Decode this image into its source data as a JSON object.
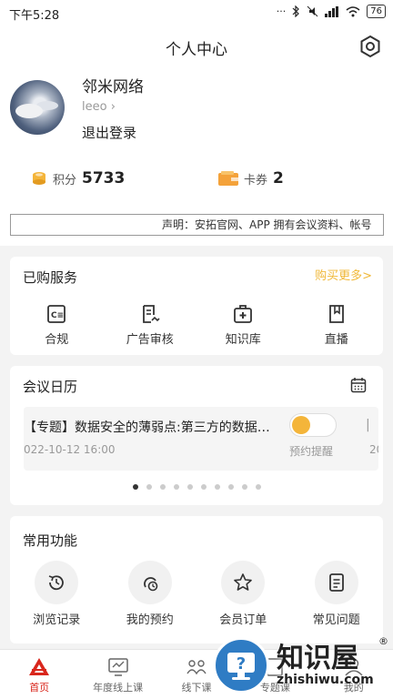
{
  "status_bar": {
    "time": "下午5:28",
    "battery": "76"
  },
  "header": {
    "title": "个人中心"
  },
  "profile": {
    "name": "邻米网络",
    "username": "leeo",
    "username_chevron": "›",
    "logout": "退出登录"
  },
  "stats": {
    "points_label": "积分",
    "points_value": "5733",
    "coupons_label": "卡券",
    "coupons_value": "2"
  },
  "notice": {
    "text": "声明：安拓官网、APP 拥有会议资料、帐号"
  },
  "purchased": {
    "title": "已购服务",
    "more": "购买更多>",
    "items": [
      {
        "label": "合规",
        "icon": "compliance-icon"
      },
      {
        "label": "广告审核",
        "icon": "ad-review-icon"
      },
      {
        "label": "知识库",
        "icon": "knowledge-base-icon"
      },
      {
        "label": "直播",
        "icon": "live-icon"
      }
    ]
  },
  "calendar": {
    "title": "会议日历",
    "item": {
      "title": "【专题】数据安全的薄弱点:第三方的数据…",
      "date": "022-10-12 16:00",
      "remind": "预约提醒"
    },
    "next_peek": {
      "title": "|",
      "date": "20"
    },
    "dots_total": 10,
    "active_dot": 0
  },
  "common": {
    "title": "常用功能",
    "items": [
      {
        "label": "浏览记录",
        "icon": "history-icon"
      },
      {
        "label": "我的预约",
        "icon": "reservation-icon"
      },
      {
        "label": "会员订单",
        "icon": "star-icon"
      },
      {
        "label": "常见问题",
        "icon": "faq-icon"
      }
    ]
  },
  "tabbar": {
    "tabs": [
      {
        "label": "首页",
        "icon": "home-logo-icon"
      },
      {
        "label": "年度线上课",
        "icon": "online-course-icon"
      },
      {
        "label": "线下课",
        "icon": "offline-course-icon"
      },
      {
        "label": "专题课",
        "icon": "topic-course-icon"
      },
      {
        "label": "我的",
        "icon": "mine-icon"
      }
    ]
  },
  "watermark": {
    "big": "知识屋",
    "small": "zhishiwu.com",
    "reg": "®"
  },
  "colors": {
    "accent": "#f0b838",
    "tab_active": "#d9261c",
    "toggle_knob": "#f4b53a"
  }
}
